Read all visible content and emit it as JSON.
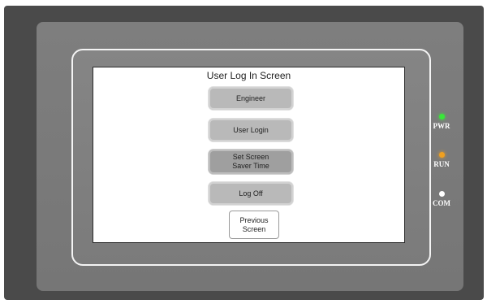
{
  "screen": {
    "title": "User Log In Screen",
    "buttons": {
      "engineer": "Engineer",
      "user_login": "User Login",
      "set_screen_saver_line1": "Set Screen",
      "set_screen_saver_line2": "Saver Time",
      "log_off": "Log Off",
      "previous_line1": "Previous",
      "previous_line2": "Screen"
    }
  },
  "indicators": [
    {
      "label": "PWR",
      "color": "#39e639"
    },
    {
      "label": "RUN",
      "color": "#f0a020"
    },
    {
      "label": "COM",
      "color": "#ffffff"
    }
  ]
}
